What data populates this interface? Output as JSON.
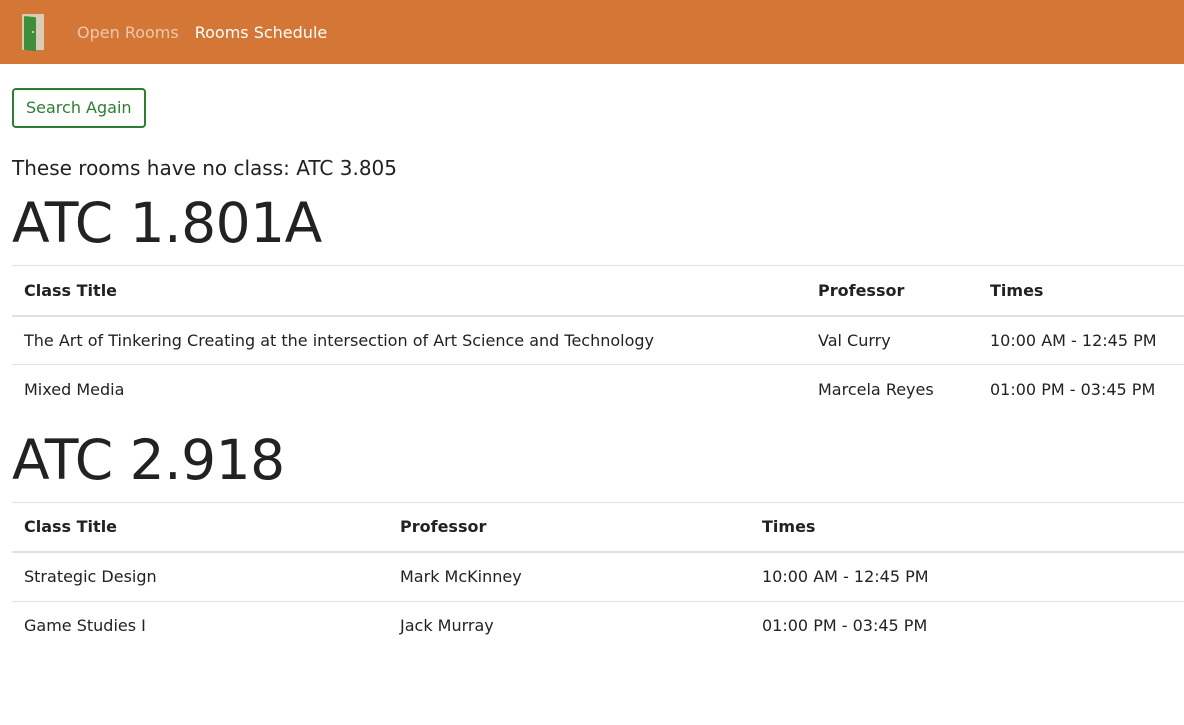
{
  "nav": {
    "logo_icon": "door-icon",
    "links": [
      {
        "label": "Open Rooms",
        "active": false
      },
      {
        "label": "Rooms Schedule",
        "active": true
      }
    ]
  },
  "search_button": {
    "label": "Search Again"
  },
  "no_class_text": "These rooms have no class: ATC 3.805",
  "rooms": [
    {
      "name": "ATC 1.801A",
      "columns": [
        "Class Title",
        "Professor",
        "Times"
      ],
      "rows": [
        [
          "The Art of Tinkering Creating at the intersection of Art Science and Technology",
          "Val Curry",
          "10:00 AM - 12:45 PM"
        ],
        [
          "Mixed Media",
          "Marcela Reyes",
          "01:00 PM - 03:45 PM"
        ]
      ]
    },
    {
      "name": "ATC 2.918",
      "columns": [
        "Class Title",
        "Professor",
        "Times"
      ],
      "rows": [
        [
          "Strategic Design",
          "Mark McKinney",
          "10:00 AM - 12:45 PM"
        ],
        [
          "Game Studies I",
          "Jack Murray",
          "01:00 PM - 03:45 PM"
        ]
      ]
    }
  ],
  "colors": {
    "navbar": "#d47636",
    "button_border": "#2e7d32"
  }
}
